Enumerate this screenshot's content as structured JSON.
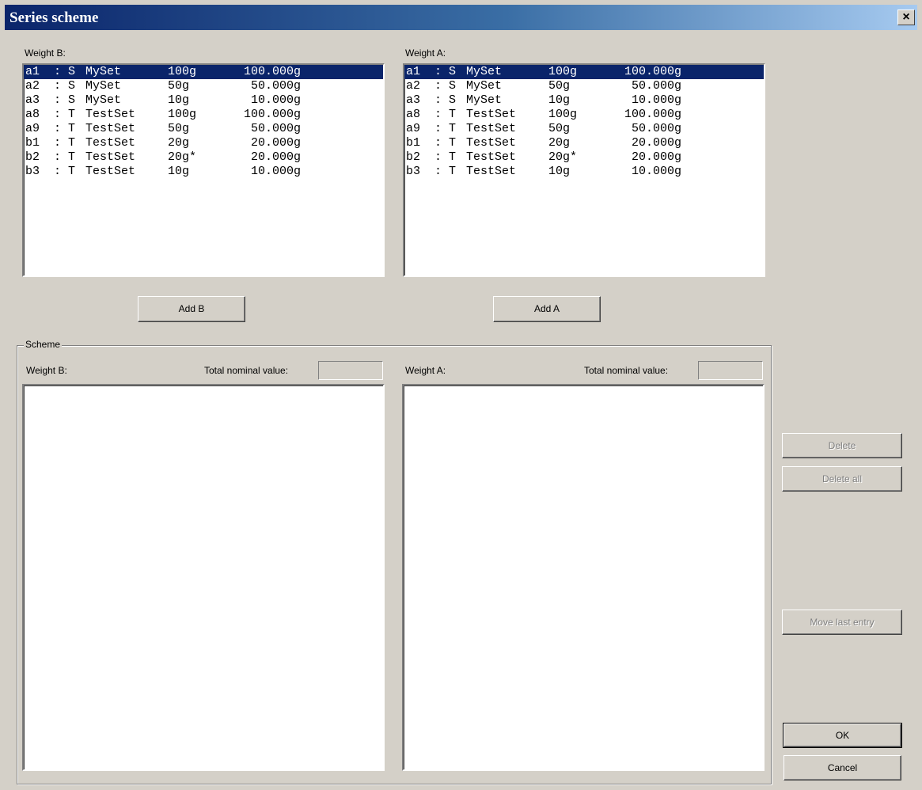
{
  "window": {
    "title": "Series scheme",
    "close_glyph": "×"
  },
  "top": {
    "weight_b_label": "Weight B:",
    "weight_a_label": "Weight A:",
    "add_b_label": "Add B",
    "add_a_label": "Add A"
  },
  "weights_b": [
    {
      "id": "a1",
      "sep": ":",
      "type": "S",
      "set": "MySet",
      "nominal": "100g",
      "actual": "100.000g",
      "selected": true
    },
    {
      "id": "a2",
      "sep": ":",
      "type": "S",
      "set": "MySet",
      "nominal": "50g",
      "actual": "50.000g"
    },
    {
      "id": "a3",
      "sep": ":",
      "type": "S",
      "set": "MySet",
      "nominal": "10g",
      "actual": "10.000g"
    },
    {
      "id": "a8",
      "sep": ":",
      "type": "T",
      "set": "TestSet",
      "nominal": "100g",
      "actual": "100.000g"
    },
    {
      "id": "a9",
      "sep": ":",
      "type": "T",
      "set": "TestSet",
      "nominal": "50g",
      "actual": "50.000g"
    },
    {
      "id": "b1",
      "sep": ":",
      "type": "T",
      "set": "TestSet",
      "nominal": "20g",
      "actual": "20.000g"
    },
    {
      "id": "b2",
      "sep": ":",
      "type": "T",
      "set": "TestSet",
      "nominal": "20g*",
      "actual": "20.000g"
    },
    {
      "id": "b3",
      "sep": ":",
      "type": "T",
      "set": "TestSet",
      "nominal": "10g",
      "actual": "10.000g"
    }
  ],
  "weights_a": [
    {
      "id": "a1",
      "sep": ":",
      "type": "S",
      "set": "MySet",
      "nominal": "100g",
      "actual": "100.000g",
      "selected": true
    },
    {
      "id": "a2",
      "sep": ":",
      "type": "S",
      "set": "MySet",
      "nominal": "50g",
      "actual": "50.000g"
    },
    {
      "id": "a3",
      "sep": ":",
      "type": "S",
      "set": "MySet",
      "nominal": "10g",
      "actual": "10.000g"
    },
    {
      "id": "a8",
      "sep": ":",
      "type": "T",
      "set": "TestSet",
      "nominal": "100g",
      "actual": "100.000g"
    },
    {
      "id": "a9",
      "sep": ":",
      "type": "T",
      "set": "TestSet",
      "nominal": "50g",
      "actual": "50.000g"
    },
    {
      "id": "b1",
      "sep": ":",
      "type": "T",
      "set": "TestSet",
      "nominal": "20g",
      "actual": "20.000g"
    },
    {
      "id": "b2",
      "sep": ":",
      "type": "T",
      "set": "TestSet",
      "nominal": "20g*",
      "actual": "20.000g"
    },
    {
      "id": "b3",
      "sep": ":",
      "type": "T",
      "set": "TestSet",
      "nominal": "10g",
      "actual": "10.000g"
    }
  ],
  "scheme": {
    "group_label": "Scheme",
    "weight_b_label": "Weight B:",
    "weight_a_label": "Weight A:",
    "total_b_label": "Total nominal value:",
    "total_a_label": "Total nominal value:",
    "total_b_value": "",
    "total_a_value": ""
  },
  "buttons": {
    "delete": "Delete",
    "delete_all": "Delete all",
    "move_last": "Move last entry",
    "ok": "OK",
    "cancel": "Cancel"
  },
  "colors": {
    "selection": "#0a246a",
    "face": "#d4d0c8",
    "disabled_text": "#808080"
  }
}
